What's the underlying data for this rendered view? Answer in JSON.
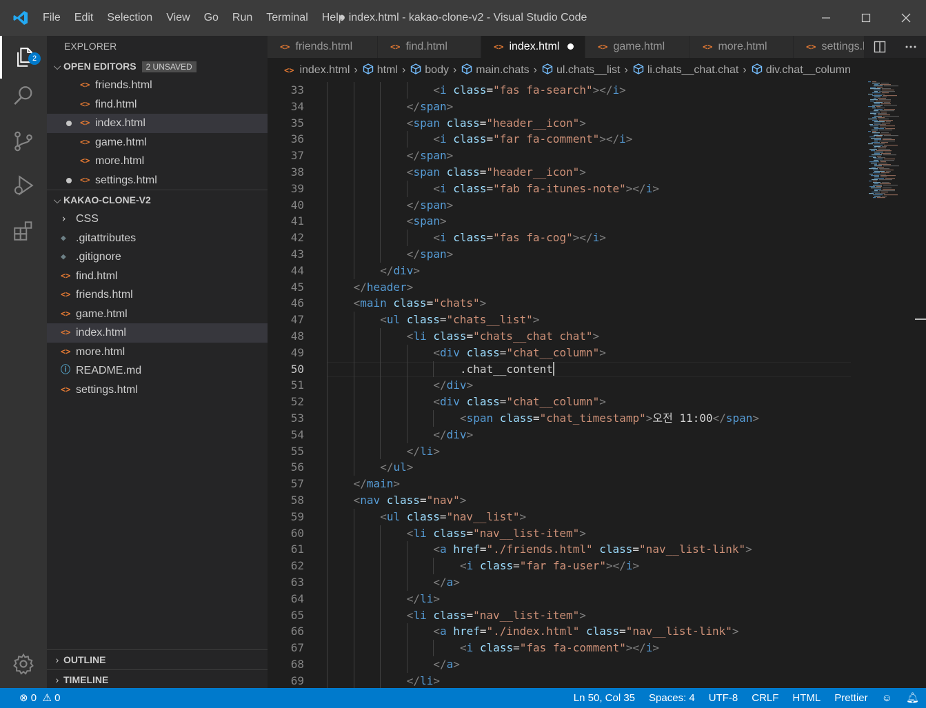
{
  "titlebar": {
    "title": "● index.html - kakao-clone-v2 - Visual Studio Code",
    "menus": [
      "File",
      "Edit",
      "Selection",
      "View",
      "Go",
      "Run",
      "Terminal",
      "Help"
    ]
  },
  "activity": {
    "explorer_badge": "2"
  },
  "sidebar": {
    "header": "EXPLORER",
    "open_editors": {
      "label": "OPEN EDITORS",
      "badge": "2 UNSAVED",
      "items": [
        {
          "name": "friends.html",
          "dirty": false,
          "selected": false
        },
        {
          "name": "find.html",
          "dirty": false,
          "selected": false
        },
        {
          "name": "index.html",
          "dirty": true,
          "selected": true
        },
        {
          "name": "game.html",
          "dirty": false,
          "selected": false
        },
        {
          "name": "more.html",
          "dirty": false,
          "selected": false
        },
        {
          "name": "settings.html",
          "dirty": true,
          "selected": false
        }
      ]
    },
    "project": {
      "label": "KAKAO-CLONE-V2",
      "items": [
        {
          "name": "CSS",
          "kind": "folder",
          "selected": false
        },
        {
          "name": ".gitattributes",
          "kind": "git",
          "selected": false
        },
        {
          "name": ".gitignore",
          "kind": "git",
          "selected": false
        },
        {
          "name": "find.html",
          "kind": "html",
          "selected": false
        },
        {
          "name": "friends.html",
          "kind": "html",
          "selected": false
        },
        {
          "name": "game.html",
          "kind": "html",
          "selected": false
        },
        {
          "name": "index.html",
          "kind": "html",
          "selected": true
        },
        {
          "name": "more.html",
          "kind": "html",
          "selected": false
        },
        {
          "name": "README.md",
          "kind": "info",
          "selected": false
        },
        {
          "name": "settings.html",
          "kind": "html",
          "selected": false
        }
      ]
    },
    "outline": "OUTLINE",
    "timeline": "TIMELINE"
  },
  "tabs": [
    {
      "label": "friends.html",
      "active": false
    },
    {
      "label": "find.html",
      "active": false
    },
    {
      "label": "index.html",
      "active": true,
      "modified": true
    },
    {
      "label": "game.html",
      "active": false
    },
    {
      "label": "more.html",
      "active": false
    },
    {
      "label": "settings.html",
      "active": false
    }
  ],
  "breadcrumb": [
    "index.html",
    "html",
    "body",
    "main.chats",
    "ul.chats__list",
    "li.chats__chat.chat",
    "div.chat__column"
  ],
  "editor": {
    "current_line": 50,
    "lines": [
      {
        "n": "33",
        "indent": 4,
        "segs": [
          [
            "t",
            "<"
          ],
          [
            "tn",
            "i"
          ],
          [
            "at",
            " class"
          ],
          [
            "tx",
            "="
          ],
          [
            "st",
            "\"fas fa-search\""
          ],
          [
            "t",
            "></"
          ],
          [
            "tn",
            "i"
          ],
          [
            "t",
            ">"
          ]
        ]
      },
      {
        "n": "34",
        "indent": 3,
        "segs": [
          [
            "t",
            "</"
          ],
          [
            "tn",
            "span"
          ],
          [
            "t",
            ">"
          ]
        ]
      },
      {
        "n": "35",
        "indent": 3,
        "segs": [
          [
            "t",
            "<"
          ],
          [
            "tn",
            "span"
          ],
          [
            "at",
            " class"
          ],
          [
            "tx",
            "="
          ],
          [
            "st",
            "\"header__icon\""
          ],
          [
            "t",
            ">"
          ]
        ]
      },
      {
        "n": "36",
        "indent": 4,
        "segs": [
          [
            "t",
            "<"
          ],
          [
            "tn",
            "i"
          ],
          [
            "at",
            " class"
          ],
          [
            "tx",
            "="
          ],
          [
            "st",
            "\"far fa-comment\""
          ],
          [
            "t",
            "></"
          ],
          [
            "tn",
            "i"
          ],
          [
            "t",
            ">"
          ]
        ]
      },
      {
        "n": "37",
        "indent": 3,
        "segs": [
          [
            "t",
            "</"
          ],
          [
            "tn",
            "span"
          ],
          [
            "t",
            ">"
          ]
        ]
      },
      {
        "n": "38",
        "indent": 3,
        "segs": [
          [
            "t",
            "<"
          ],
          [
            "tn",
            "span"
          ],
          [
            "at",
            " class"
          ],
          [
            "tx",
            "="
          ],
          [
            "st",
            "\"header__icon\""
          ],
          [
            "t",
            ">"
          ]
        ]
      },
      {
        "n": "39",
        "indent": 4,
        "segs": [
          [
            "t",
            "<"
          ],
          [
            "tn",
            "i"
          ],
          [
            "at",
            " class"
          ],
          [
            "tx",
            "="
          ],
          [
            "st",
            "\"fab fa-itunes-note\""
          ],
          [
            "t",
            "></"
          ],
          [
            "tn",
            "i"
          ],
          [
            "t",
            ">"
          ]
        ]
      },
      {
        "n": "40",
        "indent": 3,
        "segs": [
          [
            "t",
            "</"
          ],
          [
            "tn",
            "span"
          ],
          [
            "t",
            ">"
          ]
        ]
      },
      {
        "n": "41",
        "indent": 3,
        "segs": [
          [
            "t",
            "<"
          ],
          [
            "tn",
            "span"
          ],
          [
            "t",
            ">"
          ]
        ]
      },
      {
        "n": "42",
        "indent": 4,
        "segs": [
          [
            "t",
            "<"
          ],
          [
            "tn",
            "i"
          ],
          [
            "at",
            " class"
          ],
          [
            "tx",
            "="
          ],
          [
            "st",
            "\"fas fa-cog\""
          ],
          [
            "t",
            "></"
          ],
          [
            "tn",
            "i"
          ],
          [
            "t",
            ">"
          ]
        ]
      },
      {
        "n": "43",
        "indent": 3,
        "segs": [
          [
            "t",
            "</"
          ],
          [
            "tn",
            "span"
          ],
          [
            "t",
            ">"
          ]
        ]
      },
      {
        "n": "44",
        "indent": 2,
        "segs": [
          [
            "t",
            "</"
          ],
          [
            "tn",
            "div"
          ],
          [
            "t",
            ">"
          ]
        ]
      },
      {
        "n": "45",
        "indent": 1,
        "segs": [
          [
            "t",
            "</"
          ],
          [
            "tn",
            "header"
          ],
          [
            "t",
            ">"
          ]
        ]
      },
      {
        "n": "46",
        "indent": 1,
        "segs": [
          [
            "t",
            "<"
          ],
          [
            "tn",
            "main"
          ],
          [
            "at",
            " class"
          ],
          [
            "tx",
            "="
          ],
          [
            "st",
            "\"chats\""
          ],
          [
            "t",
            ">"
          ]
        ]
      },
      {
        "n": "47",
        "indent": 2,
        "segs": [
          [
            "t",
            "<"
          ],
          [
            "tn",
            "ul"
          ],
          [
            "at",
            " class"
          ],
          [
            "tx",
            "="
          ],
          [
            "st",
            "\"chats__list\""
          ],
          [
            "t",
            ">"
          ]
        ]
      },
      {
        "n": "48",
        "indent": 3,
        "segs": [
          [
            "t",
            "<"
          ],
          [
            "tn",
            "li"
          ],
          [
            "at",
            " class"
          ],
          [
            "tx",
            "="
          ],
          [
            "st",
            "\"chats__chat chat\""
          ],
          [
            "t",
            ">"
          ]
        ]
      },
      {
        "n": "49",
        "indent": 4,
        "segs": [
          [
            "t",
            "<"
          ],
          [
            "tn",
            "div"
          ],
          [
            "at",
            " class"
          ],
          [
            "tx",
            "="
          ],
          [
            "st",
            "\"chat__column\""
          ],
          [
            "t",
            ">"
          ]
        ]
      },
      {
        "n": "50",
        "indent": 5,
        "segs": [
          [
            "tx",
            ".chat__content"
          ]
        ],
        "cursor": true
      },
      {
        "n": "51",
        "indent": 4,
        "segs": [
          [
            "t",
            "</"
          ],
          [
            "tn",
            "div"
          ],
          [
            "t",
            ">"
          ]
        ]
      },
      {
        "n": "52",
        "indent": 4,
        "segs": [
          [
            "t",
            "<"
          ],
          [
            "tn",
            "div"
          ],
          [
            "at",
            " class"
          ],
          [
            "tx",
            "="
          ],
          [
            "st",
            "\"chat__column\""
          ],
          [
            "t",
            ">"
          ]
        ]
      },
      {
        "n": "53",
        "indent": 5,
        "segs": [
          [
            "t",
            "<"
          ],
          [
            "tn",
            "span"
          ],
          [
            "at",
            " class"
          ],
          [
            "tx",
            "="
          ],
          [
            "st",
            "\"chat_timestamp\""
          ],
          [
            "t",
            ">"
          ],
          [
            "tx",
            "오전 11:00"
          ],
          [
            "t",
            "</"
          ],
          [
            "tn",
            "span"
          ],
          [
            "t",
            ">"
          ]
        ]
      },
      {
        "n": "54",
        "indent": 4,
        "segs": [
          [
            "t",
            "</"
          ],
          [
            "tn",
            "div"
          ],
          [
            "t",
            ">"
          ]
        ]
      },
      {
        "n": "55",
        "indent": 3,
        "segs": [
          [
            "t",
            "</"
          ],
          [
            "tn",
            "li"
          ],
          [
            "t",
            ">"
          ]
        ]
      },
      {
        "n": "56",
        "indent": 2,
        "segs": [
          [
            "t",
            "</"
          ],
          [
            "tn",
            "ul"
          ],
          [
            "t",
            ">"
          ]
        ]
      },
      {
        "n": "57",
        "indent": 1,
        "segs": [
          [
            "t",
            "</"
          ],
          [
            "tn",
            "main"
          ],
          [
            "t",
            ">"
          ]
        ]
      },
      {
        "n": "58",
        "indent": 1,
        "segs": [
          [
            "t",
            "<"
          ],
          [
            "tn",
            "nav"
          ],
          [
            "at",
            " class"
          ],
          [
            "tx",
            "="
          ],
          [
            "st",
            "\"nav\""
          ],
          [
            "t",
            ">"
          ]
        ]
      },
      {
        "n": "59",
        "indent": 2,
        "segs": [
          [
            "t",
            "<"
          ],
          [
            "tn",
            "ul"
          ],
          [
            "at",
            " class"
          ],
          [
            "tx",
            "="
          ],
          [
            "st",
            "\"nav__list\""
          ],
          [
            "t",
            ">"
          ]
        ]
      },
      {
        "n": "60",
        "indent": 3,
        "segs": [
          [
            "t",
            "<"
          ],
          [
            "tn",
            "li"
          ],
          [
            "at",
            " class"
          ],
          [
            "tx",
            "="
          ],
          [
            "st",
            "\"nav__list-item\""
          ],
          [
            "t",
            ">"
          ]
        ]
      },
      {
        "n": "61",
        "indent": 4,
        "segs": [
          [
            "t",
            "<"
          ],
          [
            "tn",
            "a"
          ],
          [
            "at",
            " href"
          ],
          [
            "tx",
            "="
          ],
          [
            "st",
            "\"./friends.html\""
          ],
          [
            "at",
            " class"
          ],
          [
            "tx",
            "="
          ],
          [
            "st",
            "\"nav__list-link\""
          ],
          [
            "t",
            ">"
          ]
        ]
      },
      {
        "n": "62",
        "indent": 5,
        "segs": [
          [
            "t",
            "<"
          ],
          [
            "tn",
            "i"
          ],
          [
            "at",
            " class"
          ],
          [
            "tx",
            "="
          ],
          [
            "st",
            "\"far fa-user\""
          ],
          [
            "t",
            "></"
          ],
          [
            "tn",
            "i"
          ],
          [
            "t",
            ">"
          ]
        ]
      },
      {
        "n": "63",
        "indent": 4,
        "segs": [
          [
            "t",
            "</"
          ],
          [
            "tn",
            "a"
          ],
          [
            "t",
            ">"
          ]
        ]
      },
      {
        "n": "64",
        "indent": 3,
        "segs": [
          [
            "t",
            "</"
          ],
          [
            "tn",
            "li"
          ],
          [
            "t",
            ">"
          ]
        ]
      },
      {
        "n": "65",
        "indent": 3,
        "segs": [
          [
            "t",
            "<"
          ],
          [
            "tn",
            "li"
          ],
          [
            "at",
            " class"
          ],
          [
            "tx",
            "="
          ],
          [
            "st",
            "\"nav__list-item\""
          ],
          [
            "t",
            ">"
          ]
        ]
      },
      {
        "n": "66",
        "indent": 4,
        "segs": [
          [
            "t",
            "<"
          ],
          [
            "tn",
            "a"
          ],
          [
            "at",
            " href"
          ],
          [
            "tx",
            "="
          ],
          [
            "st",
            "\"./index.html\""
          ],
          [
            "at",
            " class"
          ],
          [
            "tx",
            "="
          ],
          [
            "st",
            "\"nav__list-link\""
          ],
          [
            "t",
            ">"
          ]
        ]
      },
      {
        "n": "67",
        "indent": 5,
        "segs": [
          [
            "t",
            "<"
          ],
          [
            "tn",
            "i"
          ],
          [
            "at",
            " class"
          ],
          [
            "tx",
            "="
          ],
          [
            "st",
            "\"fas fa-comment\""
          ],
          [
            "t",
            "></"
          ],
          [
            "tn",
            "i"
          ],
          [
            "t",
            ">"
          ]
        ]
      },
      {
        "n": "68",
        "indent": 4,
        "segs": [
          [
            "t",
            "</"
          ],
          [
            "tn",
            "a"
          ],
          [
            "t",
            ">"
          ]
        ]
      },
      {
        "n": "69",
        "indent": 3,
        "segs": [
          [
            "t",
            "</"
          ],
          [
            "tn",
            "li"
          ],
          [
            "t",
            ">"
          ]
        ]
      }
    ]
  },
  "statusbar": {
    "errors": "0",
    "warnings": "0",
    "position": "Ln 50, Col 35",
    "spaces": "Spaces: 4",
    "encoding": "UTF-8",
    "eol": "CRLF",
    "language": "HTML",
    "formatter": "Prettier"
  },
  "colors": {
    "accent": "#007acc",
    "html_icon": "#e37933",
    "tag": "#569cd6",
    "attr": "#9cdcfe",
    "string": "#ce9178"
  }
}
